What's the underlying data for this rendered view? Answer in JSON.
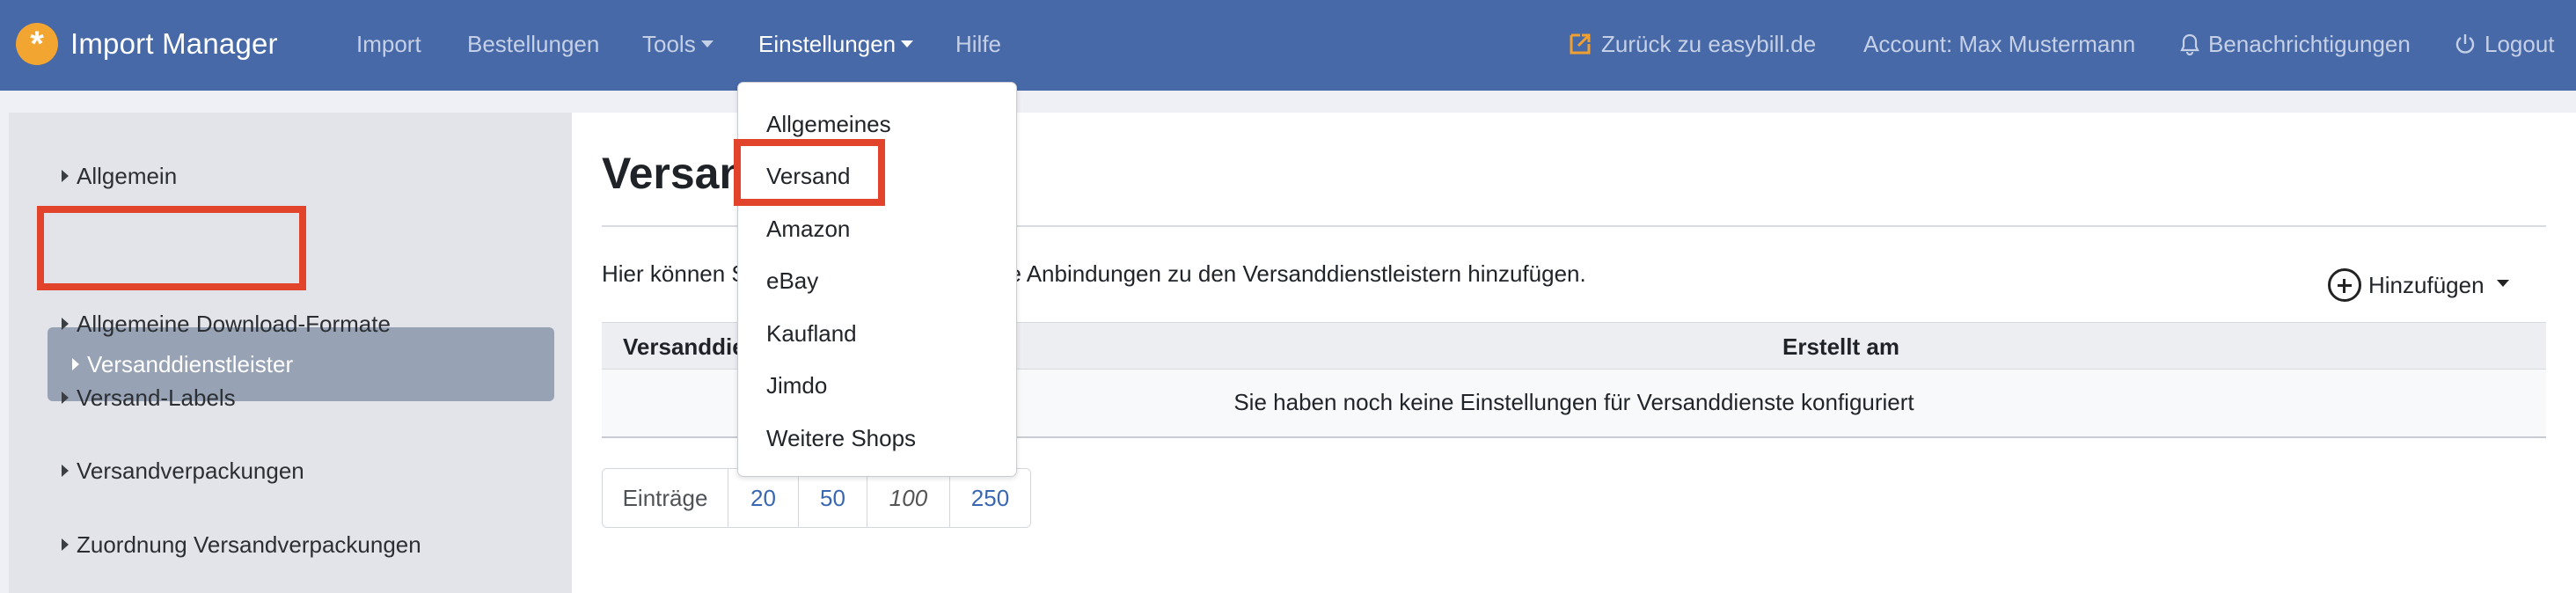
{
  "brand": {
    "title": "Import Manager",
    "logo_icon": "asterisk-logo-icon"
  },
  "nav": {
    "items": [
      {
        "label": "Import"
      },
      {
        "label": "Bestellungen"
      },
      {
        "label": "Tools"
      },
      {
        "label": "Einstellungen"
      },
      {
        "label": "Hilfe"
      }
    ],
    "right": {
      "back_link": "Zurück zu easybill.de",
      "account": "Account: Max Mustermann",
      "notifications": "Benachrichtigungen",
      "logout": "Logout"
    }
  },
  "sidebar": {
    "items": [
      {
        "label": "Allgemein"
      },
      {
        "label": "Versanddienstleister"
      },
      {
        "label": "Allgemeine Download-Formate"
      },
      {
        "label": "Versand-Labels"
      },
      {
        "label": "Versandverpackungen"
      },
      {
        "label": "Zuordnung Versandverpackungen"
      }
    ],
    "active_index": 1
  },
  "main": {
    "title": "Versand",
    "description": "Hier können Sie Ihre Datei-Exporte sowie Anbindungen zu den Versanddienstleistern hinzufügen.",
    "add_button": "Hinzufügen",
    "table": {
      "columns": [
        "Versanddienstleister",
        "Erstellt am"
      ],
      "empty_message": "Sie haben noch keine Einstellungen für Versanddienste konfiguriert"
    },
    "pager": {
      "label": "Einträge",
      "options": [
        "20",
        "50",
        "100",
        "250"
      ],
      "current": "100"
    }
  },
  "dropdown": {
    "items": [
      {
        "label": "Allgemeines"
      },
      {
        "label": "Versand"
      },
      {
        "label": "Amazon"
      },
      {
        "label": "eBay"
      },
      {
        "label": "Kaufland"
      },
      {
        "label": "Jimdo"
      },
      {
        "label": "Weitere Shops"
      }
    ],
    "highlighted_index": 1
  },
  "colors": {
    "navbar": "#4769a8",
    "highlight": "#e2442b",
    "brand_logo": "#f2a530",
    "link": "#3a67b1"
  }
}
